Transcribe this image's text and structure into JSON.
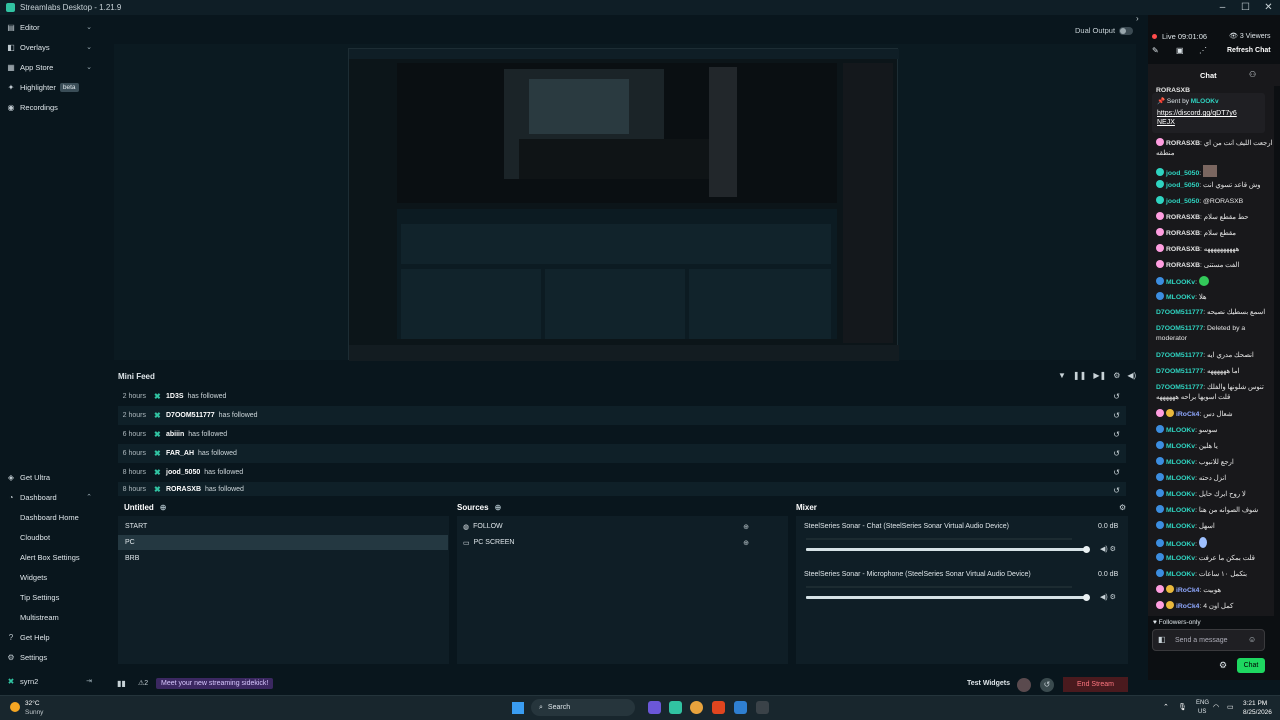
{
  "app": {
    "title": "Streamlabs Desktop - 1.21.9",
    "window_controls": [
      "–",
      "☐",
      "✕"
    ]
  },
  "sidebar": {
    "items": [
      {
        "label": "Editor",
        "icon": "editor-icon"
      },
      {
        "label": "Overlays",
        "icon": "overlays-icon"
      },
      {
        "label": "App Store",
        "icon": "appstore-icon"
      },
      {
        "label": "Highlighter",
        "icon": "highlighter-icon",
        "badge": "beta"
      },
      {
        "label": "Recordings",
        "icon": "recordings-icon"
      }
    ],
    "bottom": {
      "ultra": "Get Ultra",
      "dashboard": "Dashboard",
      "sub": [
        "Dashboard Home",
        "Cloudbot",
        "Alert Box Settings",
        "Widgets",
        "Tip Settings",
        "Multistream"
      ],
      "help": "Get Help",
      "settings": "Settings",
      "user": "syrn2"
    }
  },
  "preview": {
    "dual_output": "Dual Output"
  },
  "minifeed": {
    "title": "Mini Feed",
    "rows": [
      {
        "time": "2 hours",
        "name": "1D3S",
        "action": "has followed"
      },
      {
        "time": "2 hours",
        "name": "D7OOM511777",
        "action": "has followed"
      },
      {
        "time": "6 hours",
        "name": "abiiin",
        "action": "has followed"
      },
      {
        "time": "6 hours",
        "name": "FAR_AH",
        "action": "has followed"
      },
      {
        "time": "8 hours",
        "name": "jood_5050",
        "action": "has followed"
      },
      {
        "time": "8 hours",
        "name": "RORASXB",
        "action": "has followed"
      }
    ]
  },
  "scenes": {
    "title": "Untitled",
    "items": [
      "START",
      "PC",
      "BRB"
    ],
    "selected": "PC"
  },
  "sources": {
    "title": "Sources",
    "items": [
      "FOLLOW",
      "PC SCREEN"
    ]
  },
  "mixer": {
    "title": "Mixer",
    "channels": [
      {
        "name": "SteelSeries Sonar - Chat (SteelSeries Sonar Virtual Audio Device)",
        "db": "0.0 dB",
        "level": 1.0
      },
      {
        "name": "SteelSeries Sonar - Microphone (SteelSeries Sonar Virtual Audio Device)",
        "db": "0.0 dB",
        "level": 1.0
      }
    ]
  },
  "statusbar": {
    "alerts": "2",
    "sidekick": "Meet your new streaming sidekick!",
    "test_widgets": "Test Widgets",
    "end_stream": "End Stream"
  },
  "chat": {
    "live": "Live 09:01:06",
    "viewers": "3 Viewers",
    "refresh": "Refresh Chat",
    "tab": "Chat",
    "pinned_by": "Sent by",
    "pinned_user": "MLOOKv",
    "pinned_link": "https://discord.gg/qDT7y6NEJX",
    "messages": [
      {
        "user": "RORASXB",
        "text": "ارجعت الليف انت من اي منطقه",
        "color": "#ff9ee0"
      },
      {
        "user": "jood_5050",
        "text": "",
        "color": "#2fd4c1"
      },
      {
        "user": "jood_5050",
        "text": "وش قاعد تسوي انت",
        "color": "#2fd4c1"
      },
      {
        "user": "jood_5050",
        "text": "@RORASXB",
        "color": "#2fd4c1"
      },
      {
        "user": "RORASXB",
        "text": "حط مقطع سلام",
        "color": "#ff9ee0"
      },
      {
        "user": "RORASXB",
        "text": "مقطع سلام",
        "color": "#ff9ee0"
      },
      {
        "user": "RORASXB",
        "text": "ههههههههههه",
        "color": "#ff9ee0"
      },
      {
        "user": "RORASXB",
        "text": "الفت مستنى",
        "color": "#ff9ee0"
      },
      {
        "user": "MLOOKv",
        "text": "",
        "color": "#2fd4c1"
      },
      {
        "user": "MLOOKv",
        "text": "هلا",
        "color": "#2fd4c1"
      },
      {
        "user": "D7OOM511777",
        "text": "اسمع بسطيك نصيحه",
        "color": "#2fd4c1"
      },
      {
        "user": "D7OOM511777",
        "text": "Deleted by a moderator",
        "color": "#2fd4c1"
      },
      {
        "user": "D7OOM511777",
        "text": "انصحك مدري ايه",
        "color": "#2fd4c1"
      },
      {
        "user": "D7OOM511777",
        "text": "اما ههههههه",
        "color": "#2fd4c1"
      },
      {
        "user": "D7OOM511777",
        "text": "تنوس شلونها والفلك قلت اسويها براحه ههههههه",
        "color": "#2fd4c1"
      },
      {
        "user": "iRoCk4",
        "text": "شعال دس",
        "color": "#2fd4c1"
      },
      {
        "user": "MLOOKv",
        "text": "سوسو",
        "color": "#2fd4c1"
      },
      {
        "user": "MLOOKv",
        "text": "يا هلين",
        "color": "#2fd4c1"
      },
      {
        "user": "MLOOKv",
        "text": "ارجع للانبوب",
        "color": "#2fd4c1"
      },
      {
        "user": "MLOOKv",
        "text": "انزل دحته",
        "color": "#2fd4c1"
      },
      {
        "user": "MLOOKv",
        "text": "لا روح ابرك حايل",
        "color": "#2fd4c1"
      },
      {
        "user": "MLOOKv",
        "text": "شوف الصوانه من هنا",
        "color": "#2fd4c1"
      },
      {
        "user": "MLOOKv",
        "text": "اسهل",
        "color": "#2fd4c1"
      },
      {
        "user": "MLOOKv",
        "text": "",
        "color": "#2fd4c1"
      },
      {
        "user": "MLOOKv",
        "text": "قلت بمكن ما عرفت",
        "color": "#2fd4c1"
      },
      {
        "user": "MLOOKv",
        "text": "بتكمل ١٠ ساعات",
        "color": "#2fd4c1"
      },
      {
        "user": "iRoCk4",
        "text": "هوبيت",
        "color": "#2fd4c1"
      },
      {
        "user": "iRoCk4",
        "text": "كمل اون 4",
        "color": "#2fd4c1"
      }
    ],
    "followers_only": "Followers-only",
    "send_placeholder": "Send a message",
    "chat_button": "Chat"
  },
  "taskbar": {
    "temp": "32°C",
    "condition": "Sunny",
    "search": "Search",
    "lang1": "ENG",
    "lang2": "US",
    "time": "3:21 PM",
    "date": "8/25/2026"
  }
}
